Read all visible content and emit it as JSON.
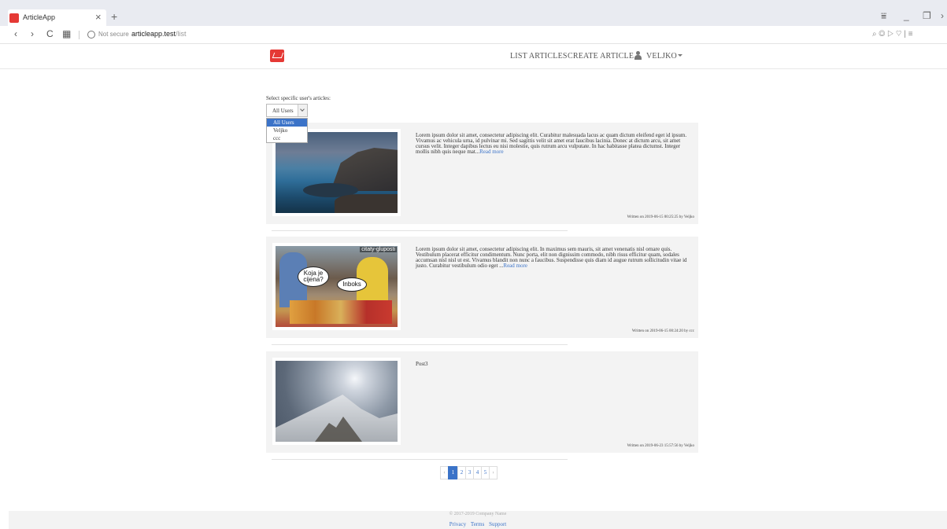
{
  "browser": {
    "tab_title": "ArticleApp",
    "close_glyph": "×",
    "new_tab_glyph": "+",
    "security": "Not secure",
    "host": "articleapp.test",
    "path": "/list",
    "nav_back": "‹",
    "nav_forward": "›",
    "reload": "C",
    "grid": "▦",
    "right_icons": "⌕  ◎  ▷  ♡  |  ≡",
    "win_controls": [
      "⩸",
      "_",
      "❐",
      "›"
    ]
  },
  "header": {
    "nav": {
      "list_articles": "LIST ARTICLES",
      "create_article": "CREATE ARTICLE",
      "user": "VELJKO"
    }
  },
  "filter": {
    "label": "Select specific user's articles:",
    "selected": "All Users",
    "options": [
      "All Users",
      "Veljko",
      "ccc"
    ]
  },
  "articles": [
    {
      "excerpt": "Lorem ipsum dolor sit amet, consectetur adipiscing elit. Curabitur malesuada lacus ac quam dictum eleifend eget id ipsum. Vivamus ac vehicula urna, id pulvinar mi. Sed sagittis velit sit amet erat faucibus lacinia. Donec at dictum arcu, sit amet cursus velit. Integer dapibus lectus eu nisi molestie, quis rutrum arcu vulputate. In hac habitasse platea dictumst. Integer mollis nibh quis neque mat...",
      "read_more": "Read more",
      "meta": "Written on 2019-06-15 00:25:25 by Veljko",
      "image": "sea-cliff-photo"
    },
    {
      "excerpt": "Lorem ipsum dolor sit amet, consectetur adipiscing elit. In maximus sem mauris, sit amet venenatis nisl ornare quis. Vestibulum placerat efficitur condimentum. Nunc porta, elit non dignissim commodo, nibh risus efficitur quam, sodales accumsan nisl nisl ut est. Vivamus blandit non nunc a faucibus. Suspendisse quis diam id augue rutrum sollicitudin vitae id justo. Curabitur vestibulum odio eget ...",
      "read_more": "Read more",
      "meta": "Written on 2019-06-15 00:24:20 by ccc",
      "image": "market-photo",
      "image_texts": {
        "watermark": "citaty-gluposti",
        "bubble1": "Koja je cijena?",
        "bubble2": "Inboks"
      }
    },
    {
      "excerpt": "Post3",
      "read_more": "",
      "meta": "Written on 2019-06-23 15:57:56 by Veljko",
      "image": "snowy-mountain-photo"
    }
  ],
  "pagination": {
    "prev": "‹",
    "pages": [
      "1",
      "2",
      "3",
      "4",
      "5"
    ],
    "next": "›",
    "active": "1"
  },
  "footer": {
    "copyright": "© 2017-2019 Company Name",
    "links": [
      "Privacy",
      "Terms",
      "Support"
    ]
  },
  "colors": {
    "link": "#3b73c8",
    "brand": "#e53935",
    "card_bg": "#f3f3f3"
  }
}
